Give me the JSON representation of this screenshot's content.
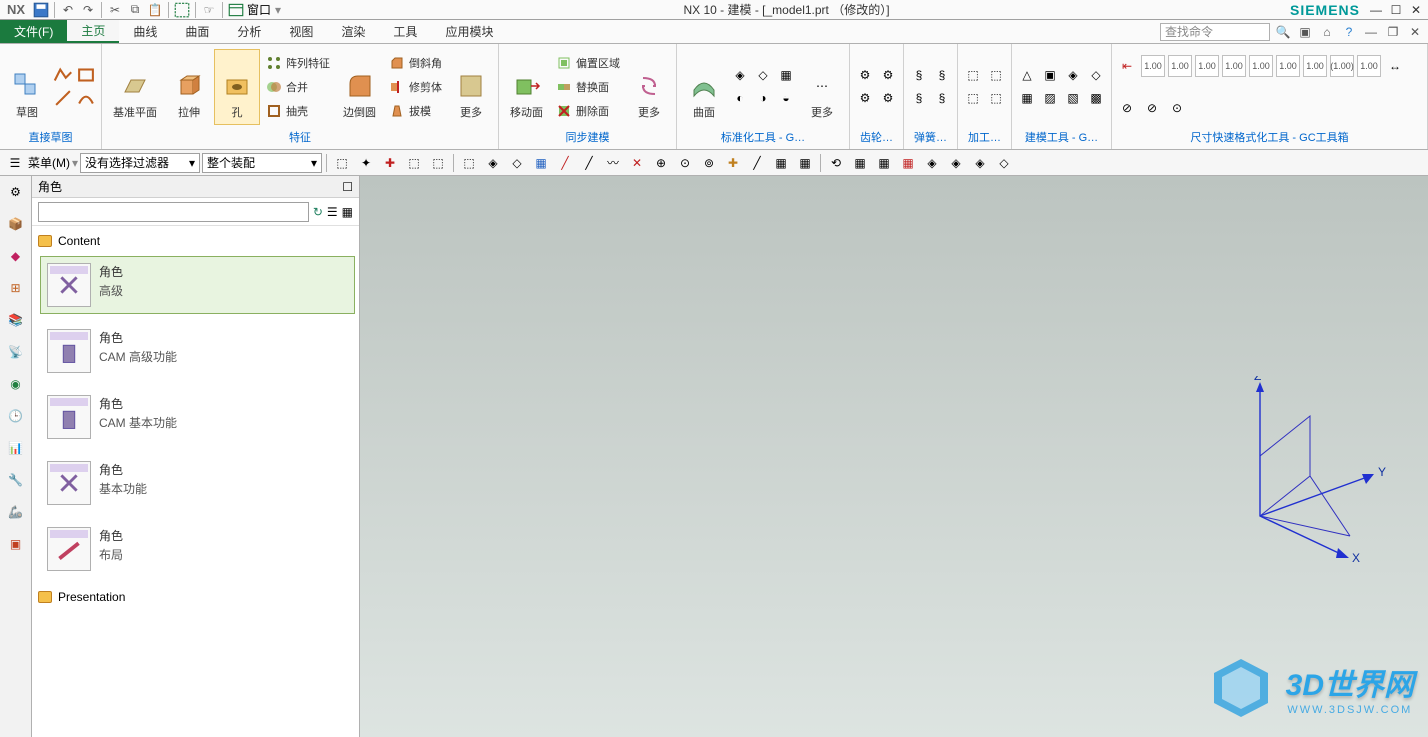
{
  "titlebar": {
    "logo": "NX",
    "window_menu": "窗口",
    "title": "NX 10 - 建模 - [_model1.prt （修改的）]",
    "brand": "SIEMENS"
  },
  "ribbon": {
    "file_tab": "文件(F)",
    "tabs": [
      "主页",
      "曲线",
      "曲面",
      "分析",
      "视图",
      "渲染",
      "工具",
      "应用模块"
    ],
    "search_placeholder": "查找命令"
  },
  "groups": {
    "sketch": {
      "btn1": "草图",
      "label": "直接草图"
    },
    "feature": {
      "datum": "基准平面",
      "extrude": "拉伸",
      "hole": "孔",
      "pattern": "阵列特征",
      "combine": "合并",
      "shell": "抽壳",
      "chamfer": "边倒圆",
      "more": "更多",
      "label": "特征",
      "bevel": "倒斜角",
      "trim": "修剪体",
      "draft": "拔模"
    },
    "sync": {
      "move": "移动面",
      "offset": "偏置区域",
      "replace": "替换面",
      "delete": "删除面",
      "more": "更多",
      "label": "同步建模"
    },
    "surface": {
      "btn": "曲面",
      "more": "更多"
    },
    "groups_labels": {
      "std": "标准化工具 - G…",
      "gear": "齿轮…",
      "spring": "弹簧…",
      "machining": "加工…",
      "modeling": "建模工具 - G…",
      "dim": "尺寸快速格式化工具 - GC工具箱"
    }
  },
  "selbar": {
    "menu": "菜单(M)",
    "filter": "没有选择过滤器",
    "assembly": "整个装配"
  },
  "side": {
    "title": "角色",
    "folder1": "Content",
    "folder2": "Presentation",
    "roles": [
      {
        "name": "角色",
        "desc": "高级"
      },
      {
        "name": "角色",
        "desc": "CAM 高级功能"
      },
      {
        "name": "角色",
        "desc": "CAM 基本功能"
      },
      {
        "name": "角色",
        "desc": "基本功能"
      },
      {
        "name": "角色",
        "desc": "布局"
      }
    ]
  },
  "viewport": {
    "axes": {
      "x": "X",
      "y": "Y",
      "z": "Z"
    }
  },
  "watermark": {
    "text": "3D世界网",
    "sub": "WWW.3DSJW.COM"
  },
  "dim_samples": [
    "1.00",
    "1.00",
    "1.00",
    "1.00",
    "1.00",
    "1.00",
    "1.00",
    "(1.00)",
    "1.00"
  ]
}
